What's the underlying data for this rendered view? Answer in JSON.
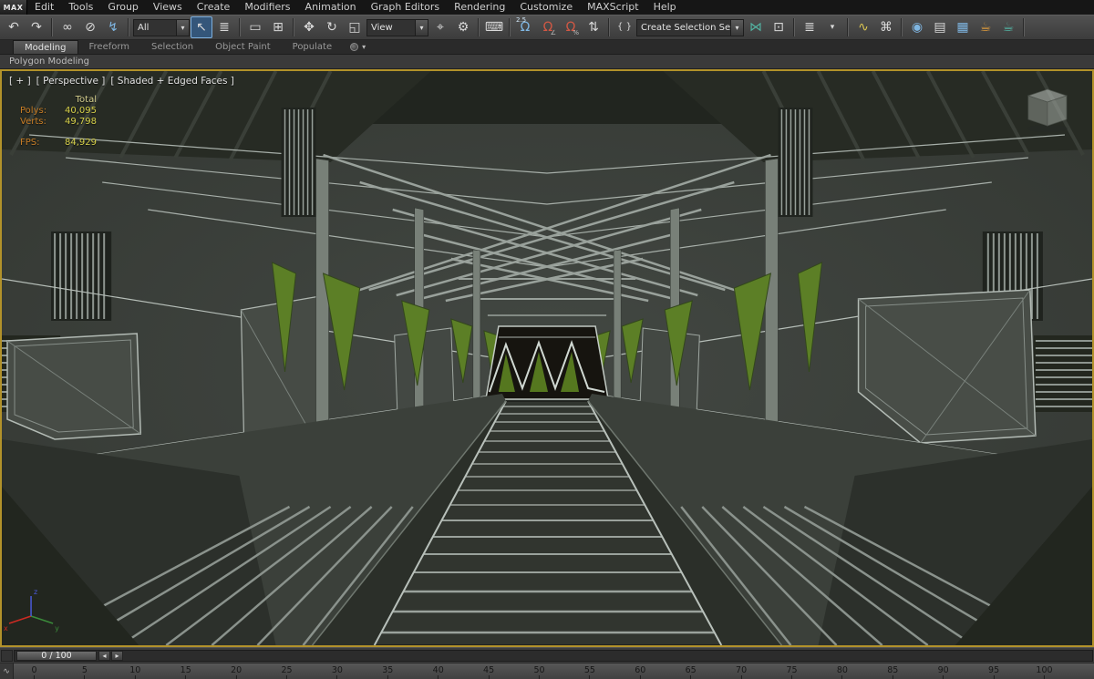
{
  "app": {
    "logo": "MAX"
  },
  "menubar": {
    "items": [
      "Edit",
      "Tools",
      "Group",
      "Views",
      "Create",
      "Modifiers",
      "Animation",
      "Graph Editors",
      "Rendering",
      "Customize",
      "MAXScript",
      "Help"
    ]
  },
  "toolbar": {
    "selection_filter": "All",
    "coord_system": "View",
    "named_sets": "Create Selection Se",
    "snap_label": "2.5",
    "dropdown_arrow": "▾",
    "icon_glyphs": {
      "undo": "↶",
      "redo": "↷",
      "link": "∞",
      "unlink": "⊘",
      "bind": "↯",
      "select": "↖",
      "select_by_name": "≣",
      "rect_region": "▭",
      "window_crossing": "⊞",
      "move": "✥",
      "rotate": "↻",
      "scale": "◱",
      "pivot": "⌖",
      "manipulate": "⚙",
      "keyboard": "⌨",
      "snap_magnet": "Ω",
      "angle": "∠",
      "percent": "%",
      "spinner": "⇅",
      "named_sets_edit": "{ }",
      "mirror": "⋈",
      "align": "⊡",
      "layers": "≣",
      "ribbon_toggle": "▾",
      "curve_editor": "∿",
      "schematic": "⌘",
      "material": "◉",
      "render_setup": "▤",
      "rendered_frame": "▦",
      "render_production": "☕",
      "render_iterative": "☕"
    }
  },
  "ribbon": {
    "tabs": [
      {
        "label": "Modeling",
        "active": true
      },
      {
        "label": "Freeform",
        "active": false
      },
      {
        "label": "Selection",
        "active": false
      },
      {
        "label": "Object Paint",
        "active": false
      },
      {
        "label": "Populate",
        "active": false
      }
    ],
    "panel_title": "Polygon Modeling"
  },
  "viewport": {
    "label_general": "[ + ]",
    "label_pov": "[ Perspective ]",
    "label_shading": "[ Shaded + Edged Faces ]",
    "stats": {
      "total_header": "Total",
      "polys_label": "Polys:",
      "polys_value": "40,095",
      "verts_label": "Verts:",
      "verts_value": "49,798",
      "fps_label": "FPS:",
      "fps_value": "84,929"
    },
    "axis": {
      "x": "x",
      "y": "y",
      "z": "z"
    }
  },
  "timeline": {
    "slider_value": "0 / 100",
    "prev_arrow": "◂",
    "next_arrow": "▸",
    "trackbar_button": "∿",
    "ticks": [
      0,
      5,
      10,
      15,
      20,
      25,
      30,
      35,
      40,
      45,
      50,
      55,
      60,
      65,
      70,
      75,
      80,
      85,
      90,
      95,
      100
    ]
  },
  "colors": {
    "active_viewport_border": "#b2922a",
    "stats_label": "#c87e27",
    "stats_value": "#d7d14b",
    "banner_green": "#5c7f26"
  }
}
